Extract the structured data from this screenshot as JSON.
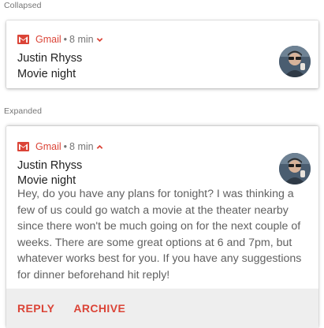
{
  "collapsed_section": {
    "label": "Collapsed",
    "notification": {
      "app_name": "Gmail",
      "separator": "•",
      "time": "8 min",
      "sender": "Justin Rhyss",
      "subject": "Movie night",
      "chevron_icon": "chevron-down-icon"
    }
  },
  "expanded_section": {
    "label": "Expanded",
    "notification": {
      "app_name": "Gmail",
      "separator": "•",
      "time": "8 min",
      "sender": "Justin Rhyss",
      "subject": "Movie night",
      "body": "Hey, do you have any plans for tonight? I was thinking a few of us could go watch a movie at the theater nearby since there won't be much going on for the next couple of weeks. There are some great options at 6 and 7pm, but whatever works best for you. If you have any suggestions for dinner beforehand hit reply!",
      "chevron_icon": "chevron-up-icon",
      "actions": [
        {
          "label": "REPLY"
        },
        {
          "label": "ARCHIVE"
        }
      ]
    }
  },
  "colors": {
    "accent": "#db4437",
    "action_bar_bg": "#eeeeee",
    "secondary_text": "#757575",
    "body_text": "#616161"
  }
}
